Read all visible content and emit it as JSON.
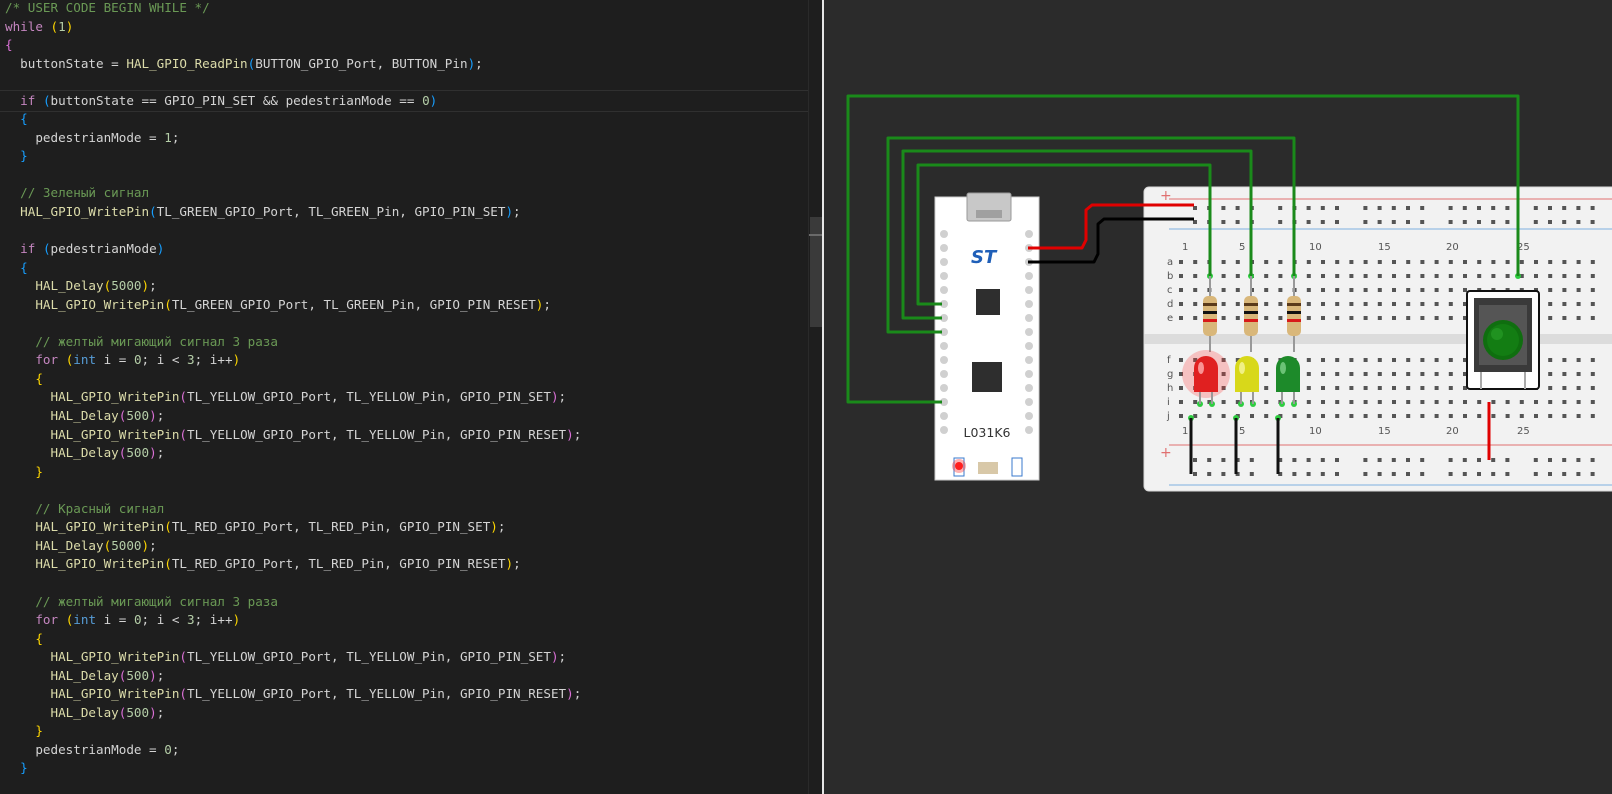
{
  "editor": {
    "lines": [
      [
        [
          "/* USER CODE BEGIN WHILE */",
          "comment"
        ]
      ],
      [
        [
          "while",
          "kw"
        ],
        [
          " ",
          "plain"
        ],
        [
          "(",
          "b1"
        ],
        [
          "1",
          "num"
        ],
        [
          ")",
          "b1"
        ]
      ],
      [
        [
          "{",
          "b2"
        ]
      ],
      [
        [
          "  buttonState = ",
          "plain"
        ],
        [
          "HAL_GPIO_ReadPin",
          "fn"
        ],
        [
          "(",
          "b3"
        ],
        [
          "BUTTON_GPIO_Port, BUTTON_Pin",
          "plain"
        ],
        [
          ")",
          "b3"
        ],
        [
          ";",
          "plain"
        ]
      ],
      [
        [
          "",
          "plain"
        ]
      ],
      [
        [
          "  ",
          "plain"
        ],
        [
          "if",
          "kw"
        ],
        [
          " ",
          "plain"
        ],
        [
          "(",
          "b3"
        ],
        [
          "buttonState == GPIO_PIN_SET && pedestrianMode == ",
          "plain"
        ],
        [
          "0",
          "num"
        ],
        [
          ")",
          "b3"
        ]
      ],
      [
        [
          "  ",
          "plain"
        ],
        [
          "{",
          "b3"
        ]
      ],
      [
        [
          "    pedestrianMode = ",
          "plain"
        ],
        [
          "1",
          "num"
        ],
        [
          ";",
          "plain"
        ]
      ],
      [
        [
          "  ",
          "plain"
        ],
        [
          "}",
          "b3"
        ]
      ],
      [
        [
          "",
          "plain"
        ]
      ],
      [
        [
          "  // Зеленый сигнал",
          "comment"
        ]
      ],
      [
        [
          "  ",
          "plain"
        ],
        [
          "HAL_GPIO_WritePin",
          "fn"
        ],
        [
          "(",
          "b3"
        ],
        [
          "TL_GREEN_GPIO_Port, TL_GREEN_Pin, GPIO_PIN_SET",
          "plain"
        ],
        [
          ")",
          "b3"
        ],
        [
          ";",
          "plain"
        ]
      ],
      [
        [
          "",
          "plain"
        ]
      ],
      [
        [
          "  ",
          "plain"
        ],
        [
          "if",
          "kw"
        ],
        [
          " ",
          "plain"
        ],
        [
          "(",
          "b3"
        ],
        [
          "pedestrianMode",
          "plain"
        ],
        [
          ")",
          "b3"
        ]
      ],
      [
        [
          "  ",
          "plain"
        ],
        [
          "{",
          "b3"
        ]
      ],
      [
        [
          "    ",
          "plain"
        ],
        [
          "HAL_Delay",
          "fn"
        ],
        [
          "(",
          "b1"
        ],
        [
          "5000",
          "num"
        ],
        [
          ")",
          "b1"
        ],
        [
          ";",
          "plain"
        ]
      ],
      [
        [
          "    ",
          "plain"
        ],
        [
          "HAL_GPIO_WritePin",
          "fn"
        ],
        [
          "(",
          "b1"
        ],
        [
          "TL_GREEN_GPIO_Port, TL_GREEN_Pin, GPIO_PIN_RESET",
          "plain"
        ],
        [
          ")",
          "b1"
        ],
        [
          ";",
          "plain"
        ]
      ],
      [
        [
          "",
          "plain"
        ]
      ],
      [
        [
          "    // желтый мигающий сигнал 3 раза",
          "comment"
        ]
      ],
      [
        [
          "    ",
          "plain"
        ],
        [
          "for",
          "kw"
        ],
        [
          " ",
          "plain"
        ],
        [
          "(",
          "b1"
        ],
        [
          "int",
          "type"
        ],
        [
          " i = ",
          "plain"
        ],
        [
          "0",
          "num"
        ],
        [
          "; i < ",
          "plain"
        ],
        [
          "3",
          "num"
        ],
        [
          "; i++",
          "plain"
        ],
        [
          ")",
          "b1"
        ]
      ],
      [
        [
          "    ",
          "plain"
        ],
        [
          "{",
          "b1"
        ]
      ],
      [
        [
          "      ",
          "plain"
        ],
        [
          "HAL_GPIO_WritePin",
          "fn"
        ],
        [
          "(",
          "b2"
        ],
        [
          "TL_YELLOW_GPIO_Port, TL_YELLOW_Pin, GPIO_PIN_SET",
          "plain"
        ],
        [
          ")",
          "b2"
        ],
        [
          ";",
          "plain"
        ]
      ],
      [
        [
          "      ",
          "plain"
        ],
        [
          "HAL_Delay",
          "fn"
        ],
        [
          "(",
          "b2"
        ],
        [
          "500",
          "num"
        ],
        [
          ")",
          "b2"
        ],
        [
          ";",
          "plain"
        ]
      ],
      [
        [
          "      ",
          "plain"
        ],
        [
          "HAL_GPIO_WritePin",
          "fn"
        ],
        [
          "(",
          "b2"
        ],
        [
          "TL_YELLOW_GPIO_Port, TL_YELLOW_Pin, GPIO_PIN_RESET",
          "plain"
        ],
        [
          ")",
          "b2"
        ],
        [
          ";",
          "plain"
        ]
      ],
      [
        [
          "      ",
          "plain"
        ],
        [
          "HAL_Delay",
          "fn"
        ],
        [
          "(",
          "b2"
        ],
        [
          "500",
          "num"
        ],
        [
          ")",
          "b2"
        ],
        [
          ";",
          "plain"
        ]
      ],
      [
        [
          "    ",
          "plain"
        ],
        [
          "}",
          "b1"
        ]
      ],
      [
        [
          "",
          "plain"
        ]
      ],
      [
        [
          "    // Красный сигнал",
          "comment"
        ]
      ],
      [
        [
          "    ",
          "plain"
        ],
        [
          "HAL_GPIO_WritePin",
          "fn"
        ],
        [
          "(",
          "b1"
        ],
        [
          "TL_RED_GPIO_Port, TL_RED_Pin, GPIO_PIN_SET",
          "plain"
        ],
        [
          ")",
          "b1"
        ],
        [
          ";",
          "plain"
        ]
      ],
      [
        [
          "    ",
          "plain"
        ],
        [
          "HAL_Delay",
          "fn"
        ],
        [
          "(",
          "b1"
        ],
        [
          "5000",
          "num"
        ],
        [
          ")",
          "b1"
        ],
        [
          ";",
          "plain"
        ]
      ],
      [
        [
          "    ",
          "plain"
        ],
        [
          "HAL_GPIO_WritePin",
          "fn"
        ],
        [
          "(",
          "b1"
        ],
        [
          "TL_RED_GPIO_Port, TL_RED_Pin, GPIO_PIN_RESET",
          "plain"
        ],
        [
          ")",
          "b1"
        ],
        [
          ";",
          "plain"
        ]
      ],
      [
        [
          "",
          "plain"
        ]
      ],
      [
        [
          "    // желтый мигающий сигнал 3 раза",
          "comment"
        ]
      ],
      [
        [
          "    ",
          "plain"
        ],
        [
          "for",
          "kw"
        ],
        [
          " ",
          "plain"
        ],
        [
          "(",
          "b1"
        ],
        [
          "int",
          "type"
        ],
        [
          " i = ",
          "plain"
        ],
        [
          "0",
          "num"
        ],
        [
          "; i < ",
          "plain"
        ],
        [
          "3",
          "num"
        ],
        [
          "; i++",
          "plain"
        ],
        [
          ")",
          "b1"
        ]
      ],
      [
        [
          "    ",
          "plain"
        ],
        [
          "{",
          "b1"
        ]
      ],
      [
        [
          "      ",
          "plain"
        ],
        [
          "HAL_GPIO_WritePin",
          "fn"
        ],
        [
          "(",
          "b2"
        ],
        [
          "TL_YELLOW_GPIO_Port, TL_YELLOW_Pin, GPIO_PIN_SET",
          "plain"
        ],
        [
          ")",
          "b2"
        ],
        [
          ";",
          "plain"
        ]
      ],
      [
        [
          "      ",
          "plain"
        ],
        [
          "HAL_Delay",
          "fn"
        ],
        [
          "(",
          "b2"
        ],
        [
          "500",
          "num"
        ],
        [
          ")",
          "b2"
        ],
        [
          ";",
          "plain"
        ]
      ],
      [
        [
          "      ",
          "plain"
        ],
        [
          "HAL_GPIO_WritePin",
          "fn"
        ],
        [
          "(",
          "b2"
        ],
        [
          "TL_YELLOW_GPIO_Port, TL_YELLOW_Pin, GPIO_PIN_RESET",
          "plain"
        ],
        [
          ")",
          "b2"
        ],
        [
          ";",
          "plain"
        ]
      ],
      [
        [
          "      ",
          "plain"
        ],
        [
          "HAL_Delay",
          "fn"
        ],
        [
          "(",
          "b2"
        ],
        [
          "500",
          "num"
        ],
        [
          ")",
          "b2"
        ],
        [
          ";",
          "plain"
        ]
      ],
      [
        [
          "    ",
          "plain"
        ],
        [
          "}",
          "b1"
        ]
      ],
      [
        [
          "    pedestrianMode = ",
          "plain"
        ],
        [
          "0",
          "num"
        ],
        [
          ";",
          "plain"
        ]
      ],
      [
        [
          "  ",
          "plain"
        ],
        [
          "}",
          "b3"
        ]
      ]
    ]
  },
  "simulator": {
    "board_label": "L031K6",
    "breadboard": {
      "row_letters": [
        "a",
        "b",
        "c",
        "d",
        "e",
        "f",
        "g",
        "h",
        "i",
        "j"
      ],
      "column_numbers": [
        "1",
        "5",
        "10",
        "15",
        "20",
        "25"
      ],
      "rail_plus": "+"
    },
    "leds": [
      {
        "name": "red-led",
        "color": "#e02020",
        "state": "on"
      },
      {
        "name": "yellow-led",
        "color": "#d8d81a",
        "state": "off"
      },
      {
        "name": "green-led",
        "color": "#1d8a2a",
        "state": "off"
      }
    ],
    "colors": {
      "wire_signal": "#1a8a1a",
      "wire_power": "#e00000",
      "wire_ground": "#000000",
      "breadboard": "#f2f2f2",
      "button_cap": "#137d13"
    }
  }
}
